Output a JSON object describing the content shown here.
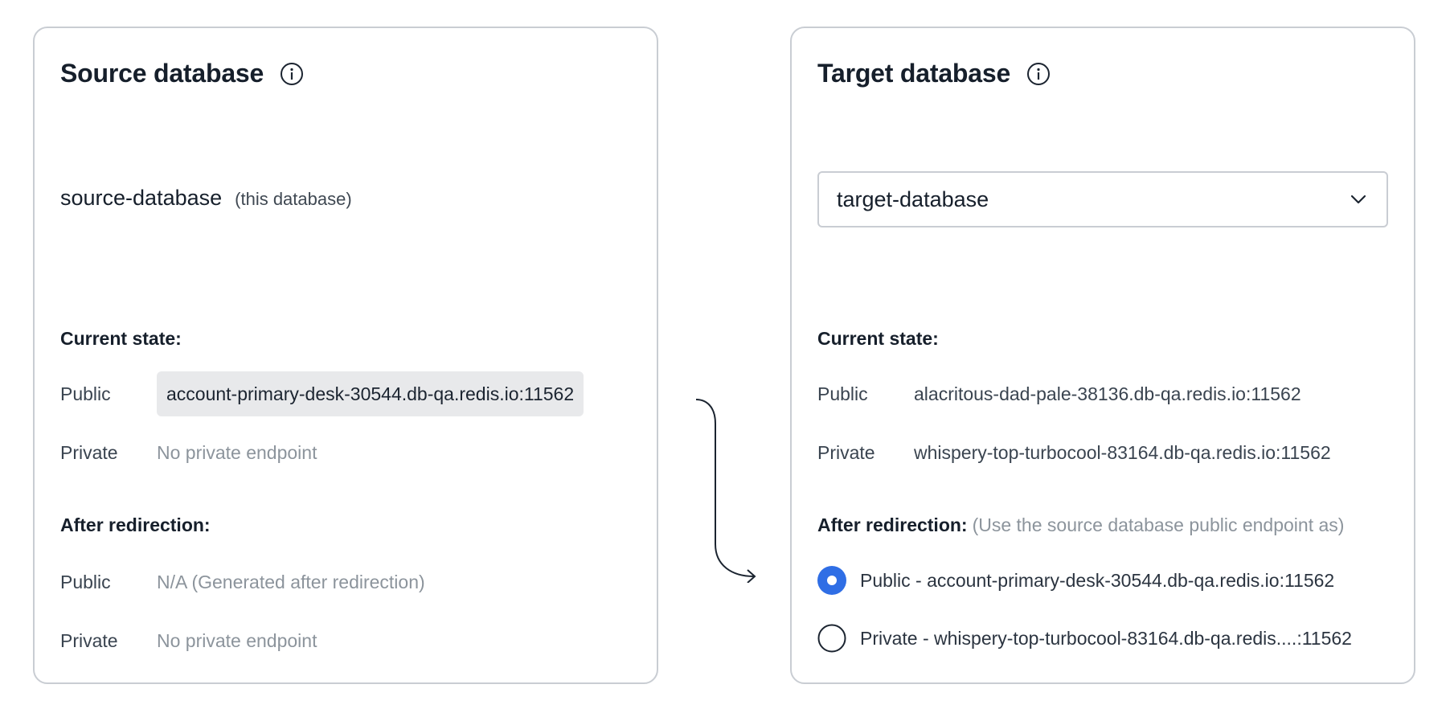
{
  "source": {
    "title": "Source database",
    "db_name": "source-database",
    "db_note": "(this database)",
    "current_state": {
      "label": "Current state:",
      "public_label": "Public",
      "public_value": "account-primary-desk-30544.db-qa.redis.io:11562",
      "private_label": "Private",
      "private_value": "No private endpoint"
    },
    "after_redirection": {
      "label": "After redirection:",
      "public_label": "Public",
      "public_value": "N/A (Generated after redirection)",
      "private_label": "Private",
      "private_value": "No private endpoint"
    }
  },
  "target": {
    "title": "Target database",
    "select_value": "target-database",
    "current_state": {
      "label": "Current state:",
      "public_label": "Public",
      "public_value": "alacritous-dad-pale-38136.db-qa.redis.io:11562",
      "private_label": "Private",
      "private_value": "whispery-top-turbocool-83164.db-qa.redis.io:11562"
    },
    "after_redirection": {
      "label": "After redirection:",
      "note": "(Use the source database public endpoint as)",
      "options": [
        {
          "label": "Public - account-primary-desk-30544.db-qa.redis.io:11562",
          "selected": true
        },
        {
          "label": "Private - whispery-top-turbocool-83164.db-qa.redis....:11562",
          "selected": false
        }
      ]
    }
  },
  "colors": {
    "accent": "#2f6ee5",
    "border": "#c9cdd3",
    "muted_text": "#8c949c",
    "pill_bg": "#e8e9eb"
  },
  "icons": {
    "info": "info-icon",
    "dropdown": "chevron-down-icon",
    "flow": "curved-arrow-icon"
  }
}
